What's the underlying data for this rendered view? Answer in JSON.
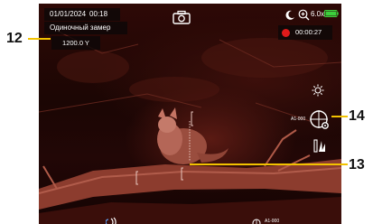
{
  "status_bar": {
    "date": "01/01/2024",
    "time": "00:18",
    "zoom_level": "6.0x",
    "battery_level": 1.0
  },
  "measurement": {
    "mode_label": "Одиночный замер",
    "distance": "1200.0 Y"
  },
  "recording": {
    "timer": "00:00:27"
  },
  "reticle": {
    "profile_label": "A1-000"
  },
  "bottom_bar": {
    "profile_label": "A1-000"
  },
  "callouts": [
    {
      "number": "12"
    },
    {
      "number": "13"
    },
    {
      "number": "14"
    }
  ],
  "colors": {
    "accent_callout": "#f2c200",
    "record_dot": "#e01a1a",
    "battery": "#3ccf3c",
    "thermal_hot": "#c97a6a"
  },
  "icons": [
    "camera-icon",
    "moon-icon",
    "zoom-icon",
    "battery-icon",
    "brightness-icon",
    "reticle-settings-icon",
    "rangefinder-icon",
    "wifi-icon"
  ]
}
